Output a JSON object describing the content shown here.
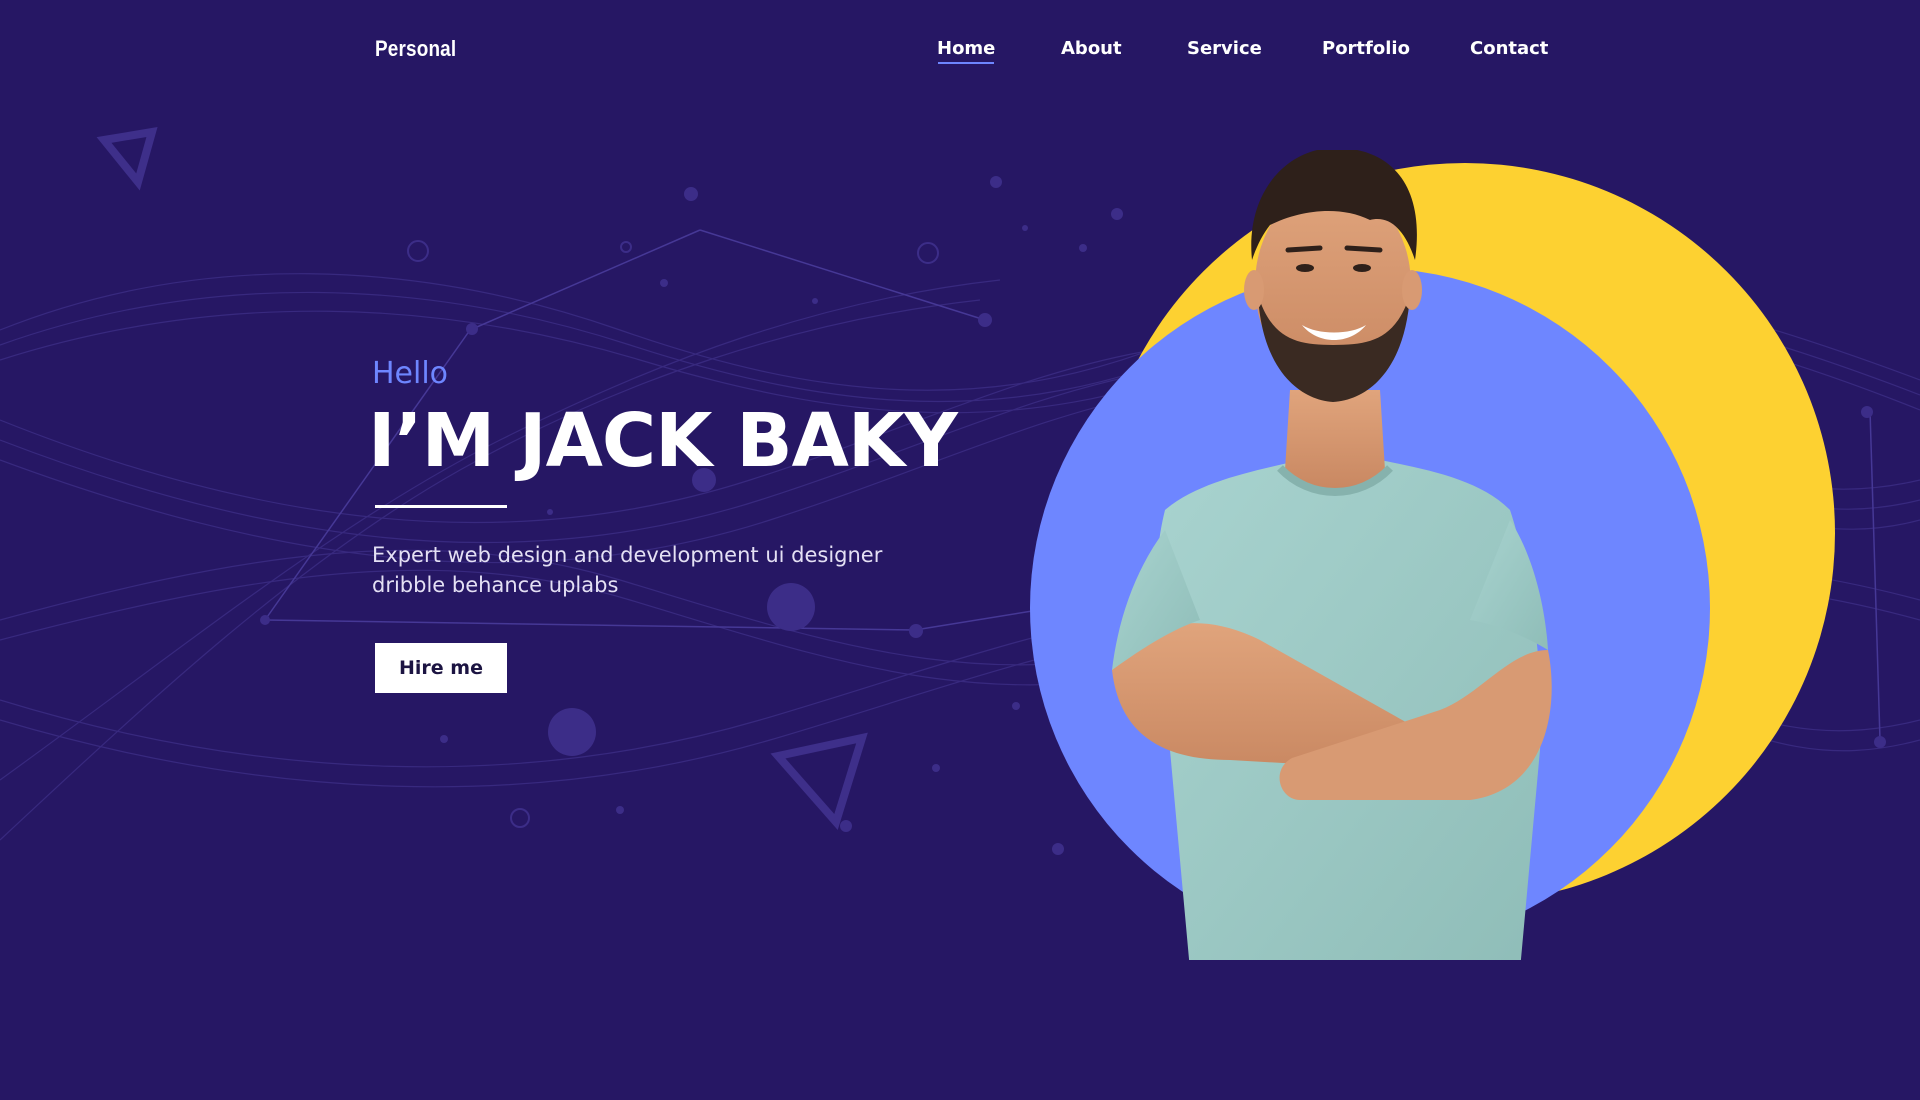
{
  "header": {
    "logo": "Personal",
    "nav": [
      {
        "label": "Home",
        "active": true
      },
      {
        "label": "About",
        "active": false
      },
      {
        "label": "Service",
        "active": false
      },
      {
        "label": "Portfolio",
        "active": false
      },
      {
        "label": "Contact",
        "active": false
      }
    ]
  },
  "hero": {
    "greeting": "Hello",
    "name": "I’M JACK BAKY",
    "description": "Expert web design and development ui designer dribble behance uplabs",
    "cta_label": "Hire me"
  },
  "colors": {
    "background": "#261764",
    "accent_blue": "#6e86ff",
    "accent_yellow": "#fdd131",
    "text_light": "#e4e0f4",
    "button_bg": "#ffffff"
  },
  "icons": [
    "triangle-outline-icon",
    "circle-dot-icon"
  ]
}
